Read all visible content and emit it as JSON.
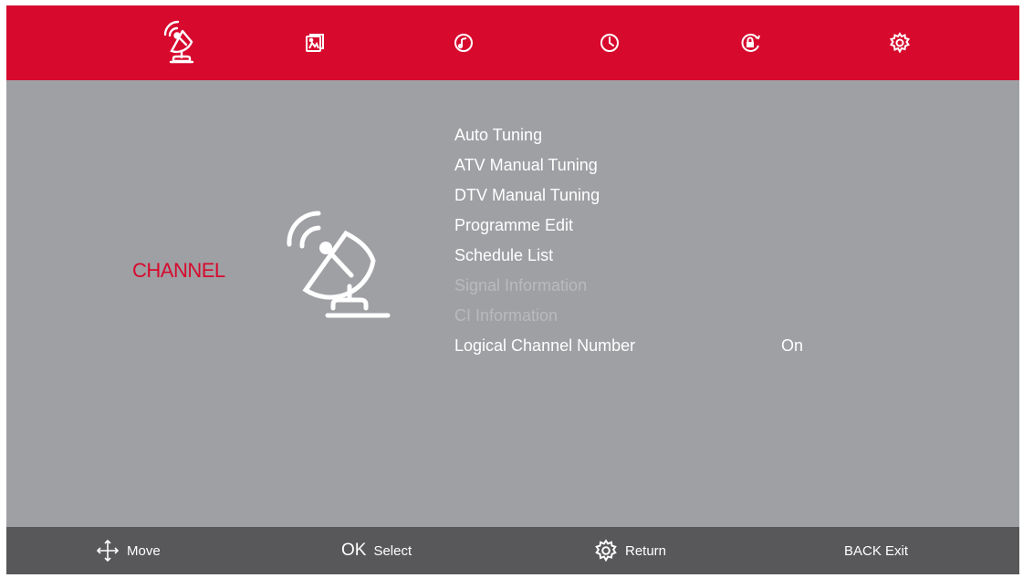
{
  "tabs": [
    {
      "icon": "satellite-dish-icon",
      "active": true
    },
    {
      "icon": "picture-icon",
      "active": false
    },
    {
      "icon": "sound-icon",
      "active": false
    },
    {
      "icon": "clock-icon",
      "active": false
    },
    {
      "icon": "lock-icon",
      "active": false
    },
    {
      "icon": "settings-gear-icon",
      "active": false
    }
  ],
  "section": {
    "title": "CHANNEL",
    "icon": "satellite-dish-icon"
  },
  "menu": [
    {
      "label": "Auto Tuning",
      "enabled": true
    },
    {
      "label": "ATV Manual Tuning",
      "enabled": true
    },
    {
      "label": "DTV Manual Tuning",
      "enabled": true
    },
    {
      "label": "Programme Edit",
      "enabled": true
    },
    {
      "label": "Schedule List",
      "enabled": true
    },
    {
      "label": "Signal Information",
      "enabled": false
    },
    {
      "label": "CI Information",
      "enabled": false
    },
    {
      "label": "Logical Channel Number",
      "value": "On",
      "enabled": true
    }
  ],
  "footer": {
    "move": {
      "icon": "move-arrows-icon",
      "label": "Move"
    },
    "select": {
      "key": "OK",
      "label": "Select"
    },
    "return": {
      "icon": "gear-icon",
      "label": "Return"
    },
    "exit": {
      "label": "BACK Exit"
    }
  },
  "colors": {
    "accent": "#d70a2e",
    "panel": "#9fa0a4",
    "footer": "#58585a",
    "text": "#ffffff",
    "disabled_text": "#b9babd"
  }
}
